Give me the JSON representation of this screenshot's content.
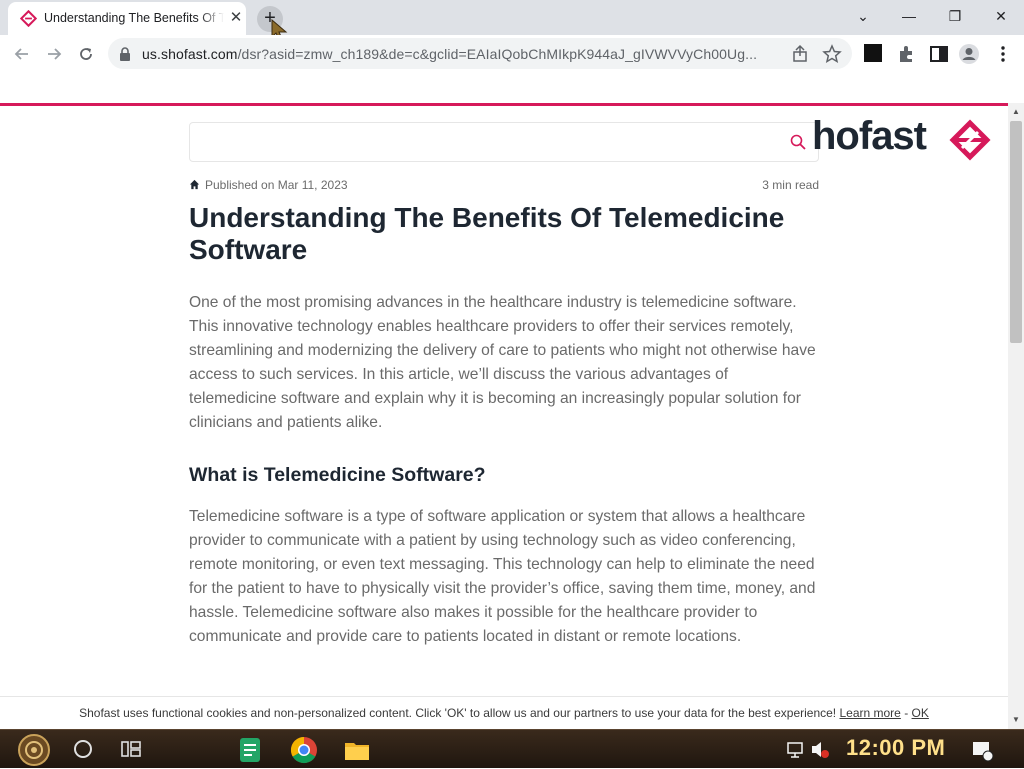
{
  "browser": {
    "tab_title": "Understanding The Benefits Of Telemedicine Software",
    "tab_close": "✕",
    "new_tab": "+",
    "window_controls": {
      "minimize": "—",
      "restore": "❐",
      "close": "✕",
      "tabsearch": "⌄"
    },
    "url_host": "us.shofast.com",
    "url_path": "/dsr?asid=zmw_ch189&de=c&gclid=EAIaIQobChMIkpK944aJ_gIVWVVyCh00Ug...",
    "accent": "#d6195a"
  },
  "page": {
    "brand": "hofast",
    "search_placeholder": "",
    "published": "Published on Mar 11, 2023",
    "read_time": "3 min read",
    "title": "Understanding The Benefits Of Telemedicine Software",
    "paragraph1": "One of the most promising advances in the healthcare industry is telemedicine software. This innovative technology enables healthcare providers to offer their services remotely, streamlining and modernizing the delivery of care to patients who might not otherwise have access to such services. In this article, we’ll discuss the various advantages of telemedicine software and explain why it is becoming an increasingly popular solution for clinicians and patients alike.",
    "heading2": "What is Telemedicine Software?",
    "paragraph2": "Telemedicine software is a type of software application or system that allows a healthcare provider to communicate with a patient by using technology such as video conferencing, remote monitoring, or even text messaging. This technology can help to eliminate the need for the patient to have to physically visit the provider’s office, saving them time, money, and hassle. Telemedicine software also makes it possible for the healthcare provider to communicate and provide care to patients located in distant or remote locations."
  },
  "cookie": {
    "text": "Shofast uses functional cookies and non-personalized content. Click 'OK' to allow us and our partners to use your data for the best experience!",
    "learn_more": "Learn more",
    "separator": "-",
    "ok": "OK"
  },
  "taskbar": {
    "clock": "12:00 PM",
    "apps": [
      "sheets-icon",
      "chrome-icon",
      "file-explorer-icon"
    ]
  }
}
